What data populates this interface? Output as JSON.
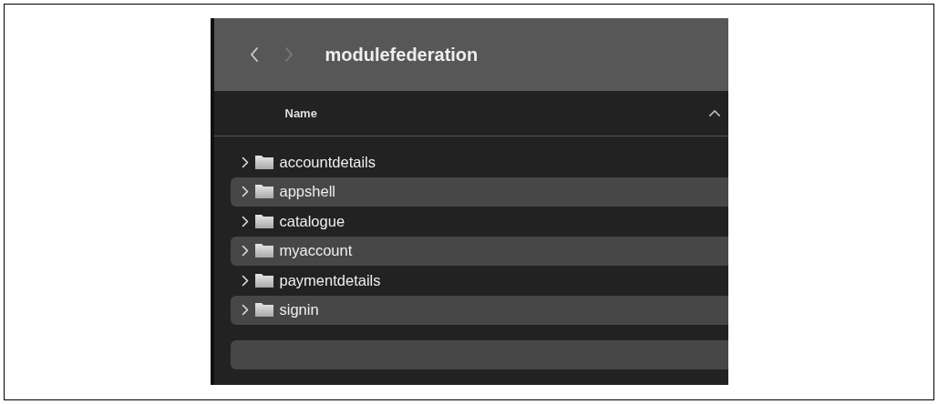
{
  "window": {
    "title": "modulefederation",
    "back_enabled": true,
    "forward_enabled": false
  },
  "table": {
    "columns": [
      {
        "label": "Name",
        "sorted_ascending": true
      }
    ],
    "rows": [
      {
        "name": "accountdetails",
        "expanded": false
      },
      {
        "name": "appshell",
        "expanded": false
      },
      {
        "name": "catalogue",
        "expanded": false
      },
      {
        "name": "myaccount",
        "expanded": false
      },
      {
        "name": "paymentdetails",
        "expanded": false
      },
      {
        "name": "signin",
        "expanded": false
      }
    ]
  }
}
